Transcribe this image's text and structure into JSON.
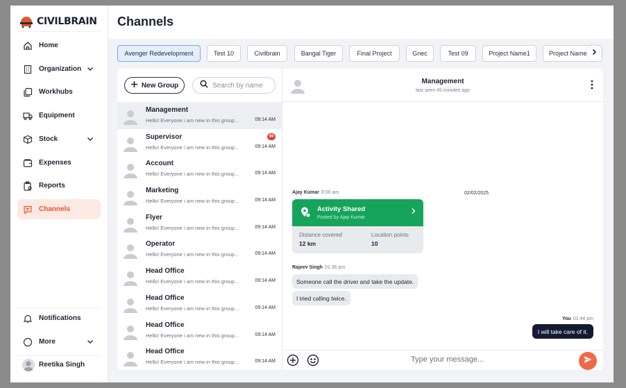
{
  "brand": {
    "name": "CIVILBRAIN"
  },
  "page": {
    "title": "Channels"
  },
  "sidebar": {
    "items": [
      {
        "label": "Home",
        "icon": "home-icon"
      },
      {
        "label": "Organization",
        "icon": "building-icon",
        "expandable": true
      },
      {
        "label": "Workhubs",
        "icon": "copy-icon"
      },
      {
        "label": "Equipment",
        "icon": "truck-icon"
      },
      {
        "label": "Stock",
        "icon": "box-icon",
        "expandable": true
      },
      {
        "label": "Expenses",
        "icon": "wallet-icon"
      },
      {
        "label": "Reports",
        "icon": "clipboard-icon"
      },
      {
        "label": "Channels",
        "icon": "chat-icon",
        "active": true
      }
    ],
    "bottom": {
      "notifications": "Notifications",
      "more": "More",
      "user": "Reetika Singh"
    }
  },
  "tabs": [
    "Avenger Redevelopment",
    "Test 10",
    "Civilbrain",
    "Bangal Tiger",
    "Final Project",
    "Gnec",
    "Test 09",
    "Project Name1",
    "Project Name"
  ],
  "channel_list": {
    "new_group": "New Group",
    "search_placeholder": "Search by name",
    "items": [
      {
        "name": "Management",
        "preview": "Hello! Everyone i am new in this group...",
        "time": "09:14 AM",
        "active": true
      },
      {
        "name": "Supervisor",
        "preview": "Hello! Everyone i am new in this group...",
        "time": "09:14 AM",
        "badge": "99"
      },
      {
        "name": "Account",
        "preview": "Hello! Everyone i am new in this group...",
        "time": "09:14 AM"
      },
      {
        "name": "Marketing",
        "preview": "Hello! Everyone i am new in this group...",
        "time": "09:14 AM"
      },
      {
        "name": "Flyer",
        "preview": "Hello! Everyone i am new in this group...",
        "time": "09:14 AM"
      },
      {
        "name": "Operator",
        "preview": "Hello! Everyone i am new in this group...",
        "time": "09:14 AM"
      },
      {
        "name": "Head Office",
        "preview": "Hello! Everyone i am new in this group...",
        "time": "09:14 AM"
      },
      {
        "name": "Head Office",
        "preview": "Hello! Everyone i am new in this group...",
        "time": "09:14 AM"
      },
      {
        "name": "Head Office",
        "preview": "Hello! Everyone i am new in this group...",
        "time": "09:14 AM"
      },
      {
        "name": "Head Office",
        "preview": "Hello! Everyone i am new in this group...",
        "time": "09:14 AM"
      }
    ]
  },
  "chat": {
    "header": {
      "title": "Management",
      "status": "last seen 45 minutes ago"
    },
    "date": "02/02/2025",
    "activity": {
      "sender": "Ajay Kumar",
      "time": "8:00 am",
      "title": "Activity Shared",
      "posted_by": "Posted by Ajay Kumar",
      "distance_label": "Distance covered",
      "distance_value": "12 km",
      "points_label": "Location points",
      "points_value": "10"
    },
    "incoming": {
      "sender": "Rajeev Singh",
      "time": "01:36 pm",
      "messages": [
        "Someone call the driver and take the update.",
        "I tried calling twice."
      ]
    },
    "outgoing": {
      "sender": "You",
      "time": "01:44 pm",
      "message": "I will take care of it."
    },
    "composer_placeholder": "Type your message..."
  },
  "colors": {
    "accent": "#ee6a45",
    "active_bg": "#fde9e3",
    "activity_green": "#16a45c",
    "outgoing_bubble": "#141a33",
    "badge": "#e53935"
  }
}
